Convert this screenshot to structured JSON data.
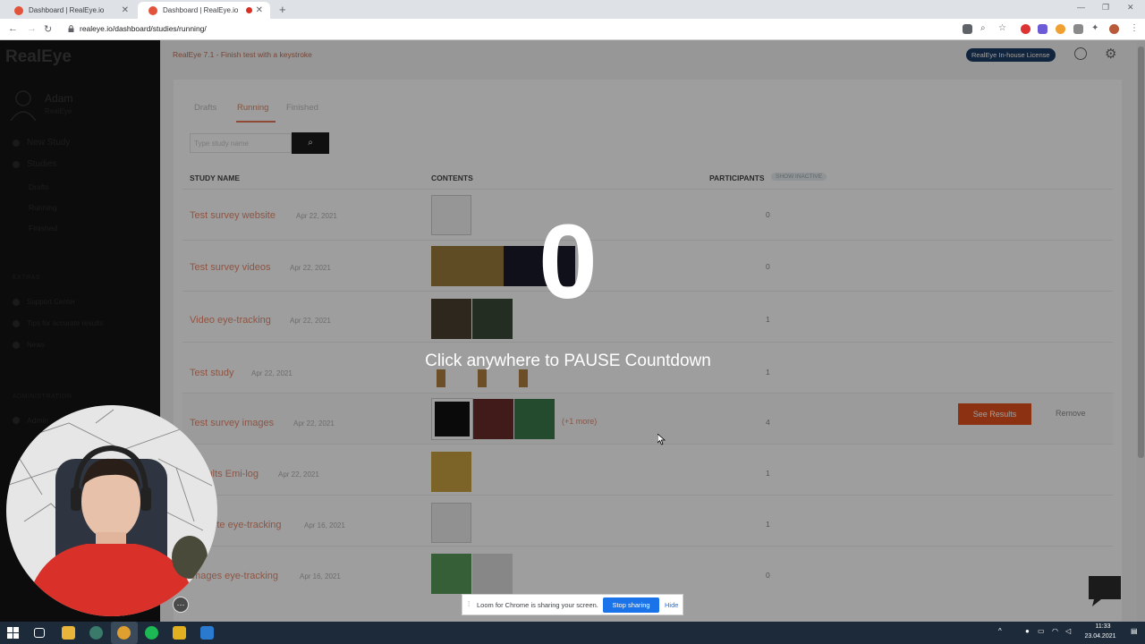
{
  "browser": {
    "tabs": [
      {
        "title": "Dashboard | RealEye.io"
      },
      {
        "title": "Dashboard | RealEye.io"
      }
    ],
    "url": "realeye.io/dashboard/studies/running/"
  },
  "sidebar": {
    "logo": "RealEye",
    "user_name": "Adam",
    "user_sub": "RealEye",
    "items": [
      {
        "label": "New Study"
      },
      {
        "label": "Studies"
      },
      {
        "label": "Drafts"
      },
      {
        "label": "Running"
      },
      {
        "label": "Finished"
      }
    ],
    "extras_title": "EXTRAS",
    "extras": [
      {
        "label": "Support Center"
      },
      {
        "label": "Tips for accurate results"
      },
      {
        "label": "News"
      }
    ],
    "admin_title": "ADMINISTRATION",
    "admin_item": "Admin"
  },
  "header": {
    "banner": "RealEye 7.1 - Finish test with a keystroke",
    "license": "RealEye In-house License"
  },
  "studies": {
    "tabs": [
      "Drafts",
      "Running",
      "Finished"
    ],
    "search_placeholder": "Type study name",
    "columns": {
      "name": "STUDY NAME",
      "contents": "CONTENTS",
      "participants": "PARTICIPANTS",
      "info": "SHOW INACTIVE"
    },
    "rows": [
      {
        "name": "Test survey website",
        "date": "Apr 22, 2021",
        "participants": "0"
      },
      {
        "name": "Test survey videos",
        "date": "Apr 22, 2021",
        "participants": "0"
      },
      {
        "name": "Video eye-tracking",
        "date": "Apr 22, 2021",
        "participants": "1"
      },
      {
        "name": "Test study",
        "date": "Apr 22, 2021",
        "participants": "1"
      },
      {
        "name": "Test survey images",
        "date": "Apr 22, 2021",
        "participants": "4",
        "more": "(+1 more)",
        "see_results": "See Results",
        "remove": "Remove"
      },
      {
        "name": "Results Emi-log",
        "date": "Apr 22, 2021",
        "participants": "1"
      },
      {
        "name": "Website eye-tracking",
        "date": "Apr 16, 2021",
        "participants": "1"
      },
      {
        "name": "Images eye-tracking",
        "date": "Apr 16, 2021",
        "participants": "0"
      }
    ]
  },
  "overlay": {
    "countdown": "0",
    "message": "Click anywhere to PAUSE Countdown"
  },
  "share_bar": {
    "text": "Loom for Chrome is sharing your screen.",
    "stop": "Stop sharing",
    "hide": "Hide"
  },
  "taskbar": {
    "time": "11:33",
    "date": "23.04.2021"
  },
  "colors": {
    "accent": "#e2521f",
    "link": "#e8896d",
    "license": "#1d3d66",
    "stop_sharing": "#1a73e8"
  }
}
